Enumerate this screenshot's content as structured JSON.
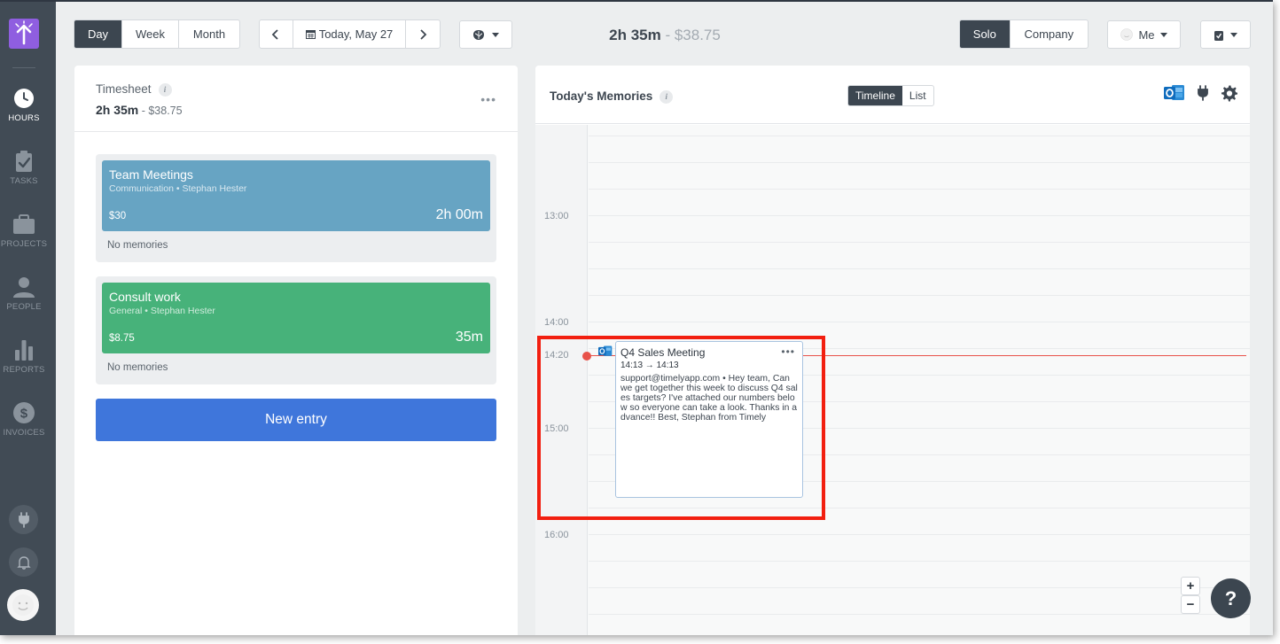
{
  "sidebar": {
    "items": [
      {
        "label": "HOURS",
        "icon": "clock-icon"
      },
      {
        "label": "TASKS",
        "icon": "clipboard-check-icon"
      },
      {
        "label": "PROJECTS",
        "icon": "briefcase-icon"
      },
      {
        "label": "PEOPLE",
        "icon": "person-icon"
      },
      {
        "label": "REPORTS",
        "icon": "bar-chart-icon"
      },
      {
        "label": "INVOICES",
        "icon": "dollar-icon"
      }
    ],
    "active": "HOURS"
  },
  "topbar": {
    "views": [
      "Day",
      "Week",
      "Month"
    ],
    "active_view": "Day",
    "date_label": "Today, May 27",
    "total_time": "2h 35m",
    "total_separator": " - ",
    "total_money": "$38.75",
    "scope": [
      "Solo",
      "Company"
    ],
    "active_scope": "Solo",
    "user_label": "Me"
  },
  "timesheet": {
    "title": "Timesheet",
    "total_time": "2h 35m",
    "total_money": " - $38.75",
    "entries": [
      {
        "name": "Team Meetings",
        "meta": "Communication • Stephan Hester",
        "rate": "$30",
        "duration": "2h 00m",
        "memories": "No memories",
        "color": "#67a4c3"
      },
      {
        "name": "Consult work",
        "meta": "General • Stephan Hester",
        "rate": "$8.75",
        "duration": "35m",
        "memories": "No memories",
        "color": "#47b27a"
      }
    ],
    "new_entry_label": "New entry"
  },
  "memories": {
    "title": "Today's Memories",
    "view_toggle": [
      "Timeline",
      "List"
    ],
    "active_toggle": "Timeline",
    "time_labels": [
      "13:00",
      "14:00",
      "14:20",
      "15:00",
      "16:00"
    ],
    "card": {
      "title": "Q4 Sales Meeting",
      "time": "14:13 → 14:13",
      "body": "support@timelyapp.com • Hey team, Can we get together this week to discuss Q4 sales targets? I've attached our numbers below so everyone can take a look. Thanks in advance!! Best, Stephan from Timely"
    },
    "zoom_in": "+",
    "zoom_out": "−",
    "help": "?"
  },
  "colors": {
    "sidebar": "#414b55",
    "accent": "#3f76db",
    "now_line": "#e8524a",
    "highlight": "#f21f10"
  }
}
